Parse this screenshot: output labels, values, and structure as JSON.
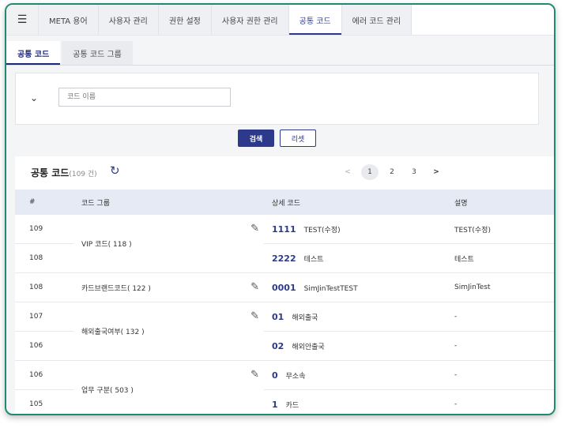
{
  "top_tabs": [
    "META 용어",
    "사용자 관리",
    "권한 설정",
    "사용자 권한 관리",
    "공통 코드",
    "에러 코드 관리"
  ],
  "active_top_tab": "공통 코드",
  "sub_tabs": [
    "공통 코드",
    "공통 코드 그룹"
  ],
  "filter": {
    "code_name_placeholder": "코드 이름"
  },
  "buttons": {
    "search": "검색",
    "reset": "리셋"
  },
  "list": {
    "title": "공통 코드",
    "count": "(109 건)"
  },
  "pagination": {
    "prev": "<",
    "pages": [
      "1",
      "2",
      "3"
    ],
    "next": ">"
  },
  "table": {
    "headers": [
      "#",
      "코드 그룹",
      "상세 코드",
      "설명"
    ],
    "rows": [
      {
        "no": "109",
        "group": "VIP 코드( 118 )",
        "code": "1111",
        "name": "TEST(수정)",
        "desc": "TEST(수정)"
      },
      {
        "no": "108",
        "group": "",
        "code": "2222",
        "name": "테스트",
        "desc": "테스트"
      },
      {
        "no": "108",
        "group": "카드브랜드코드( 122 )",
        "code": "0001",
        "name": "SimJinTestTEST",
        "desc": "SimJinTest"
      },
      {
        "no": "107",
        "group": "해외출국여부( 132 )",
        "code": "01",
        "name": "해외출국",
        "desc": "-"
      },
      {
        "no": "106",
        "group": "",
        "code": "02",
        "name": "해외안출국",
        "desc": "-"
      },
      {
        "no": "106",
        "group": "업무 구분( 503 )",
        "code": "0",
        "name": "무소속",
        "desc": "-"
      },
      {
        "no": "105",
        "group": "",
        "code": "1",
        "name": "카드",
        "desc": "-"
      }
    ]
  }
}
